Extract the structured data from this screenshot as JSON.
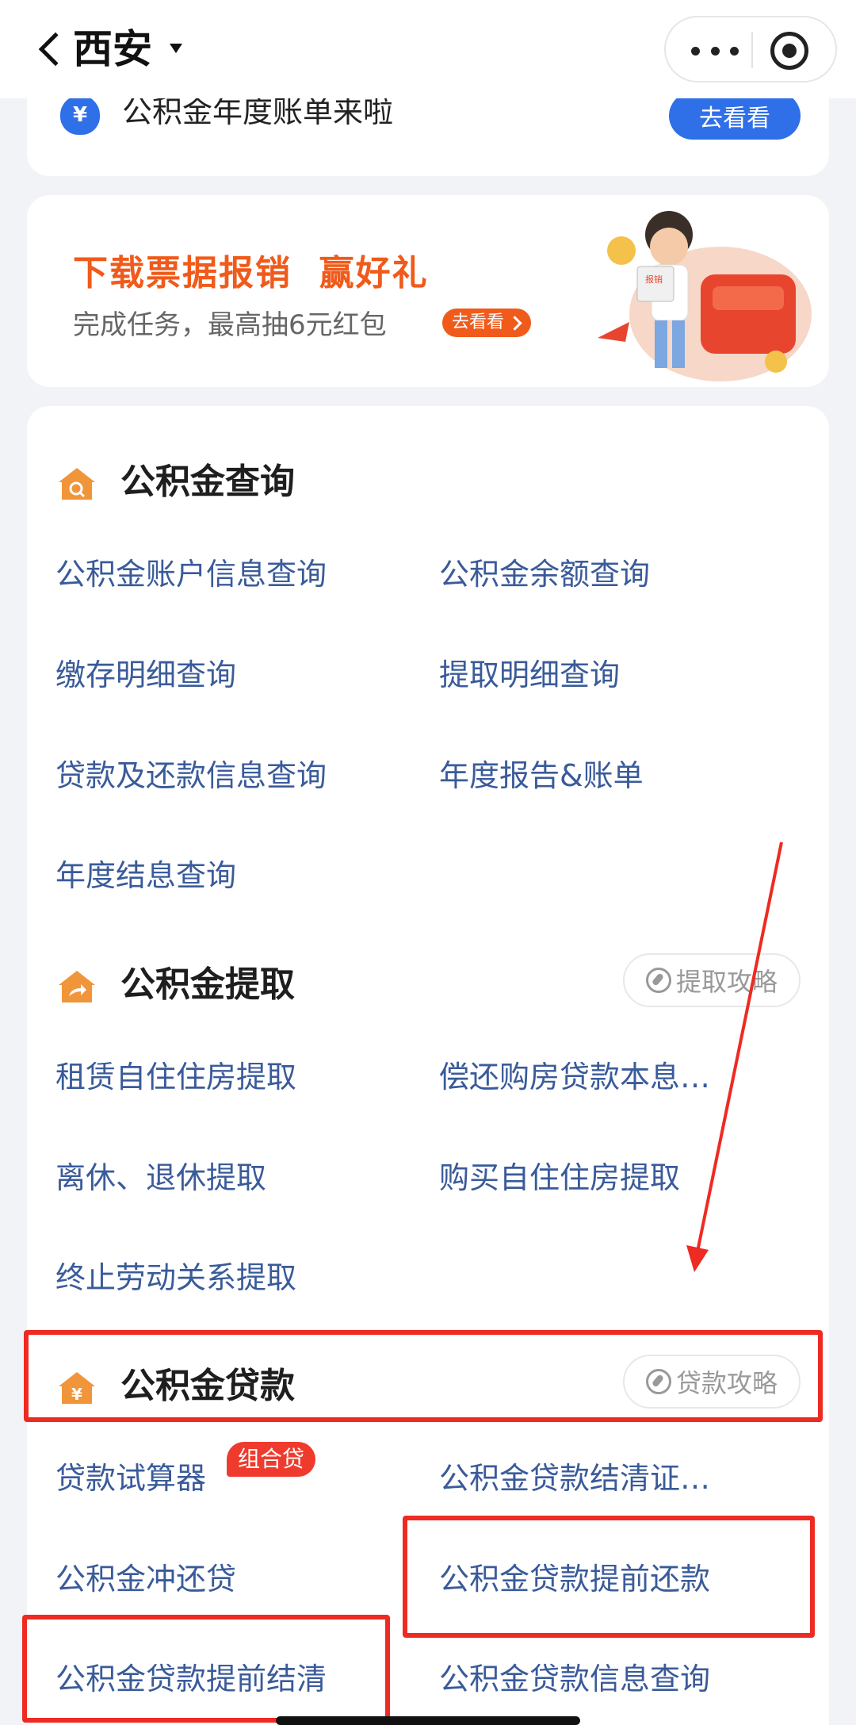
{
  "navbar": {
    "city": "西安",
    "more_icon": "more-dots-icon",
    "close_icon": "target-close-icon"
  },
  "notice": {
    "text": "公积金年度账单来啦",
    "button": "去看看",
    "icon": "money-bag-icon",
    "icon_glyph": "¥"
  },
  "promo": {
    "title": "下载票据报销  赢好礼",
    "subtitle": "完成任务，最高抽6元红包",
    "tag": "去看看",
    "art_label": "报销"
  },
  "sections": {
    "query": {
      "title": "公积金查询",
      "items": [
        "公积金账户信息查询",
        "公积金余额查询",
        "缴存明细查询",
        "提取明细查询",
        "贷款及还款信息查询",
        "年度报告&账单",
        "年度结息查询"
      ]
    },
    "withdraw": {
      "title": "公积金提取",
      "guide": "提取攻略",
      "items": [
        "租赁自住住房提取",
        "偿还购房贷款本息…",
        "离休、退休提取",
        "购买自住住房提取",
        "终止劳动关系提取"
      ]
    },
    "loan": {
      "title": "公积金贷款",
      "guide": "贷款攻略",
      "items": [
        "贷款试算器",
        "公积金贷款结清证…",
        "公积金冲还贷",
        "公积金贷款提前还款",
        "公积金贷款提前结清",
        "公积金贷款信息查询"
      ],
      "badge": "组合贷"
    }
  },
  "colors": {
    "accent_blue": "#2f6fe8",
    "promo_orange": "#f05a1a",
    "link_blue": "#3a5b9a",
    "section_icon_orange": "#f0953a",
    "annotation_red": "#ee2b22"
  }
}
